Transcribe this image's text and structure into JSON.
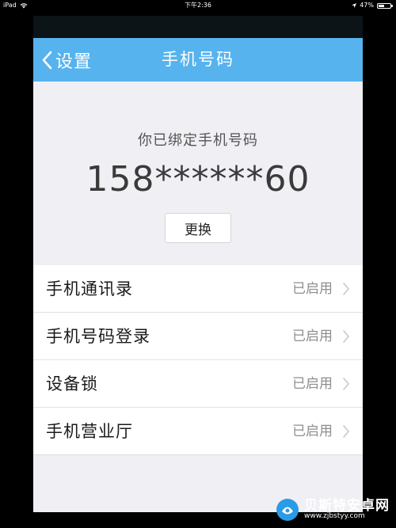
{
  "status_bar": {
    "device": "iPad",
    "time": "下午2:36",
    "battery_percent": "47%",
    "battery_level": 0.47
  },
  "nav": {
    "back_label": "设置",
    "title": "手机号码"
  },
  "bound": {
    "caption": "你已绑定手机号码",
    "phone_number": "158******60",
    "change_label": "更换"
  },
  "list": {
    "items": [
      {
        "label": "手机通讯录",
        "status": "已启用"
      },
      {
        "label": "手机号码登录",
        "status": "已启用"
      },
      {
        "label": "设备锁",
        "status": "已启用"
      },
      {
        "label": "手机营业厅",
        "status": "已启用"
      }
    ]
  },
  "watermark": {
    "name": "贝斯特安卓网",
    "url": "www.zjbstyy.com"
  },
  "colors": {
    "nav_blue": "#56b3ee",
    "background": "#efeff4",
    "status_gray": "#8e8e8e"
  }
}
